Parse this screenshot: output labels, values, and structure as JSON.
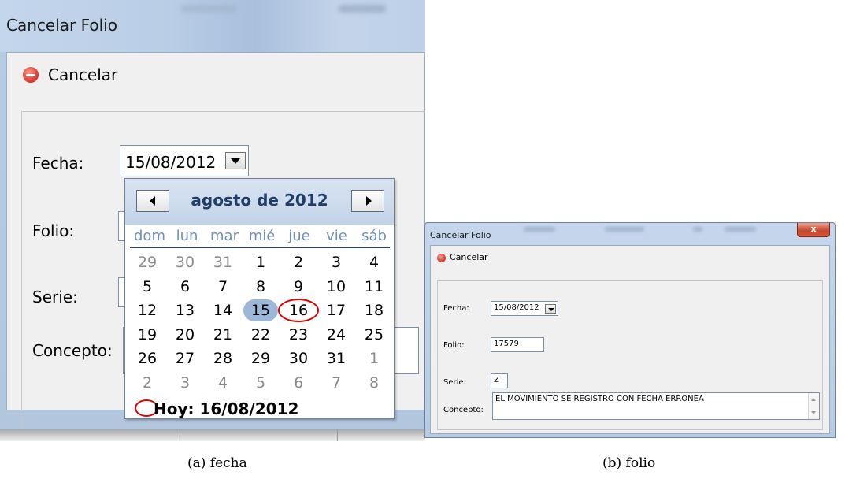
{
  "panel_a": {
    "window_title": "Cancelar Folio",
    "toolbar": {
      "cancel_label": "Cancelar"
    },
    "labels": {
      "fecha": "Fecha:",
      "folio": "Folio:",
      "serie": "Serie:",
      "concepto": "Concepto:"
    },
    "fecha_value": "15/08/2012",
    "calendar": {
      "month_title": "agosto de 2012",
      "weekdays": [
        "dom",
        "lun",
        "mar",
        "mié",
        "jue",
        "vie",
        "sáb"
      ],
      "weeks": [
        [
          "29",
          "30",
          "31",
          "1",
          "2",
          "3",
          "4"
        ],
        [
          "5",
          "6",
          "7",
          "8",
          "9",
          "10",
          "11"
        ],
        [
          "12",
          "13",
          "14",
          "15",
          "16",
          "17",
          "18"
        ],
        [
          "19",
          "20",
          "21",
          "22",
          "23",
          "24",
          "25"
        ],
        [
          "26",
          "27",
          "28",
          "29",
          "30",
          "31",
          "1"
        ],
        [
          "2",
          "3",
          "4",
          "5",
          "6",
          "7",
          "8"
        ]
      ],
      "selected_day": "15",
      "today_day": "16",
      "today_label": "Hoy: 16/08/2012"
    }
  },
  "panel_b": {
    "window_title": "Cancelar Folio",
    "close_glyph": "x",
    "toolbar": {
      "cancel_label": "Cancelar"
    },
    "labels": {
      "fecha": "Fecha:",
      "folio": "Folio:",
      "serie": "Serie:",
      "concepto": "Concepto:"
    },
    "fecha_value": "15/08/2012",
    "folio_value": "17579",
    "serie_value": "Z",
    "concepto_value": "EL MOVIMIENTO SE REGISTRO CON FECHA ERRONEA"
  },
  "captions": {
    "a": "(a)  fecha",
    "b": "(b)  folio"
  },
  "colors": {
    "title_bar": "#c4d6ec",
    "selected_day": "#9db7d8",
    "today_marker": "#e00000",
    "calendar_title": "#1f3d6b",
    "weekday": "#6f8fb8"
  }
}
